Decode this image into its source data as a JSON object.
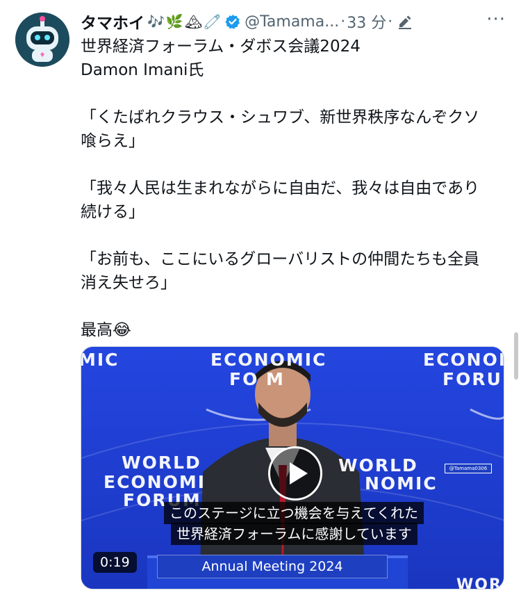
{
  "post": {
    "display_name": "タマホイ",
    "emojis": [
      "🎶",
      "🌿",
      "🏔",
      "🧷"
    ],
    "handle": "@Tamama...",
    "separator1": "·",
    "time": "33 分",
    "separator2": "·",
    "more": "···",
    "lines": [
      "世界経済フォーラム・ダボス会議2024",
      "Damon Imani氏",
      "",
      "「くたばれクラウス・シュワブ、新世界秩序なんぞクソ",
      "喰らえ」",
      "",
      "「我々人民は生まれながらに自由だ、我々は自由であり",
      "続ける」",
      "",
      "「お前も、ここにいるグローバリストの仲間たちも全員",
      "消え失せろ」",
      "",
      "最高😂"
    ]
  },
  "video": {
    "duration": "0:19",
    "subtitle_line1": "このステージに立つ機会を与えてくれた",
    "subtitle_line2": "世界経済フォーラムに感謝しています",
    "banner": "Annual Meeting 2024",
    "credit": "@Tamama0306",
    "bg_text_top_left": "MIC",
    "bg_text_top_center1": "ECONOMIC",
    "bg_text_top_center2": "FO  M",
    "bg_text_top_right1": "ECONOM",
    "bg_text_top_right2": "FORU",
    "bg_text_mid_left1": "WORLD",
    "bg_text_mid_left2": "ECONOMI",
    "bg_text_mid_left3": "FORUM",
    "bg_text_mid_right1": "WORLD",
    "bg_text_mid_right2": "NOMIC",
    "bg_text_bottom_right": "WORL"
  },
  "colors": {
    "verified": "#1d9bf0",
    "muted": "#536471",
    "video_bg": "#1f43d6"
  }
}
